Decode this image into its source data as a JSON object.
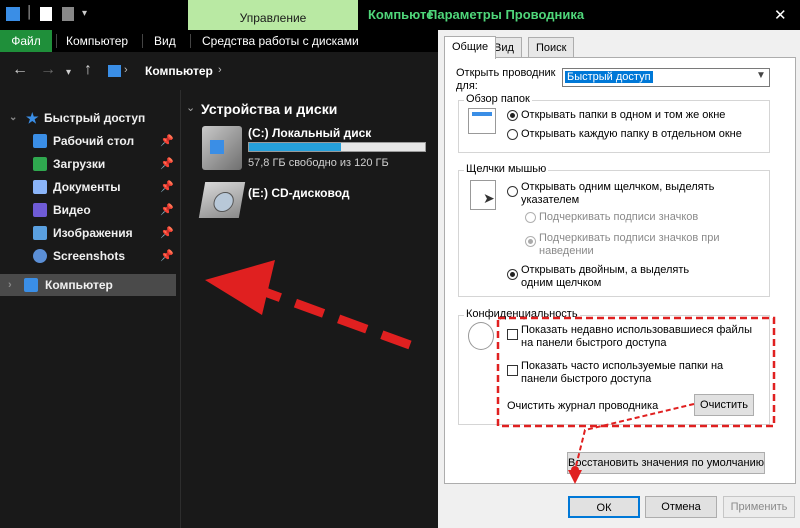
{
  "explorer": {
    "ribbon": {
      "contextual_tab": "Управление",
      "title": "Компьюте",
      "tabs": [
        "Файл",
        "Компьютер",
        "Вид",
        "Средства работы с дисками"
      ]
    },
    "address": "Компьютер",
    "sidebar": {
      "quick_access": "Быстрый доступ",
      "items": [
        {
          "label": "Рабочий стол",
          "icon": "desktop-icon",
          "color": "#3a8ee6"
        },
        {
          "label": "Загрузки",
          "icon": "downloads-icon",
          "color": "#2fa84f"
        },
        {
          "label": "Документы",
          "icon": "documents-icon",
          "color": "#8ab4f8"
        },
        {
          "label": "Видео",
          "icon": "videos-icon",
          "color": "#6f5bd6"
        },
        {
          "label": "Изображения",
          "icon": "pictures-icon",
          "color": "#5aa0e0"
        },
        {
          "label": "Screenshots",
          "icon": "screenshots-icon",
          "color": "#5b8fd6"
        }
      ],
      "computer": "Компьютер"
    },
    "content": {
      "group_title": "Устройства и диски",
      "drives": [
        {
          "name": "(C:) Локальный диск",
          "free": "57,8 ГБ свободно из 120 ГБ",
          "used_fraction": 0.52
        },
        {
          "name": "(E:) CD-дисковод"
        }
      ]
    }
  },
  "dialog": {
    "title": "Параметры Проводника",
    "close": "✕",
    "tabs": [
      "Общие",
      "Вид",
      "Поиск"
    ],
    "open_in_label": "Открыть проводник для:",
    "open_in_value": "Быстрый доступ",
    "browse": {
      "title": "Обзор папок",
      "options": [
        "Открывать папки в одном и том же окне",
        "Открывать каждую папку в отдельном окне"
      ]
    },
    "click": {
      "title": "Щелчки мышью",
      "single": "Открывать одним щелчком, выделять указателем",
      "underline_always": "Подчеркивать подписи значков",
      "underline_hover": "Подчеркивать подписи значков при наведении",
      "double": "Открывать двойным, а выделять одним щелчком"
    },
    "privacy": {
      "title": "Конфиденциальность",
      "recent_files": "Показать недавно использовавшиеся файлы на панели быстрого доступа",
      "frequent_folders": "Показать часто используемые папки на панели быстрого доступа",
      "clear_label": "Очистить журнал проводника",
      "clear_button": "Очистить"
    },
    "restore_button": "Восстановить значения по умолчанию",
    "ok": "ОК",
    "cancel": "Отмена",
    "apply": "Применить"
  },
  "colors": {
    "annotation": "#e02020",
    "accent_green": "#1f8f3a",
    "title_green": "#4fd67a"
  }
}
